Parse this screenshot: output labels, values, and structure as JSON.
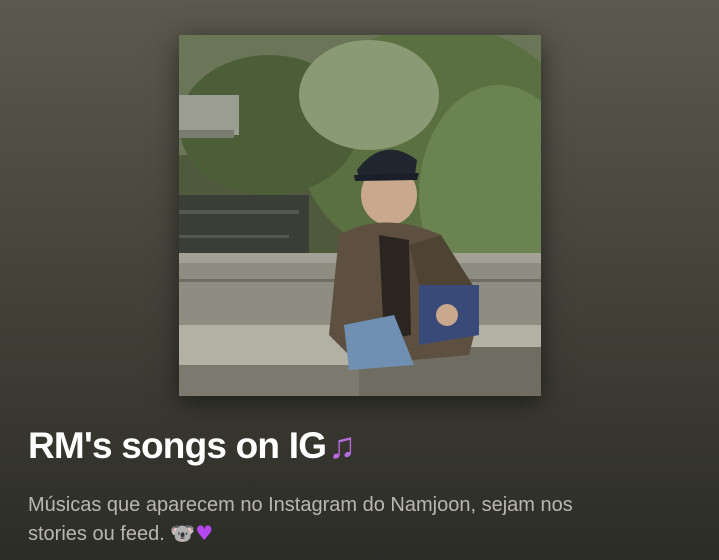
{
  "playlist": {
    "cover_image": "Photo of a man in a dark cap and brown coat crouching on a stone bridge by a pond with bamboo",
    "title": "RM's songs on IG",
    "title_emoji": "♫",
    "description_line1": "Músicas que aparecem no Instagram do Namjoon, sejam nos",
    "description_line2": "stories ou feed.",
    "description_emoji1": "🐨",
    "description_emoji2": "♥"
  },
  "colors": {
    "background_top": "#5a5a4e",
    "background_bottom": "#2c2c27",
    "description_text": "#b8b8ae",
    "note_purple": "#b66ce0",
    "heart_purple": "#b347f0"
  }
}
